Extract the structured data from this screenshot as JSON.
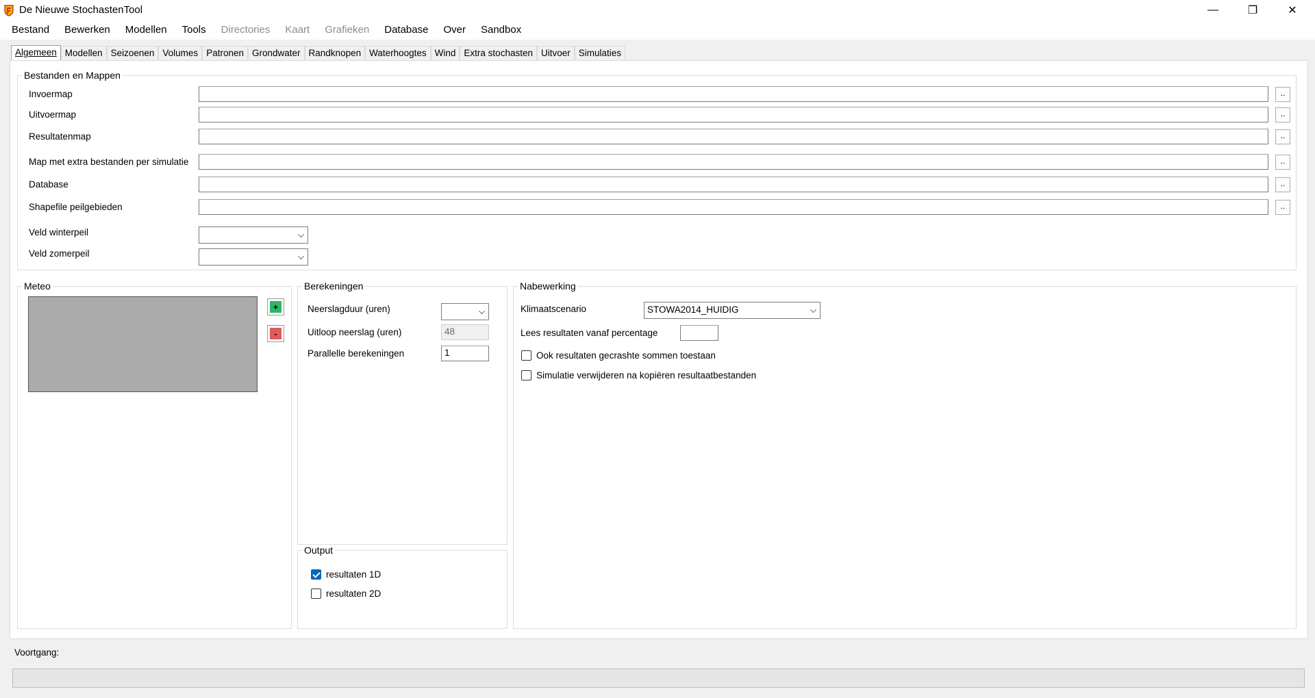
{
  "window": {
    "title": "De Nieuwe StochastenTool",
    "controls": {
      "minimize": "—",
      "restore": "❐",
      "close": "✕"
    }
  },
  "menu": [
    {
      "label": "Bestand",
      "enabled": true
    },
    {
      "label": "Bewerken",
      "enabled": true
    },
    {
      "label": "Modellen",
      "enabled": true
    },
    {
      "label": "Tools",
      "enabled": true
    },
    {
      "label": "Directories",
      "enabled": false
    },
    {
      "label": "Kaart",
      "enabled": false
    },
    {
      "label": "Grafieken",
      "enabled": false
    },
    {
      "label": "Database",
      "enabled": true
    },
    {
      "label": "Over",
      "enabled": true
    },
    {
      "label": "Sandbox",
      "enabled": true
    }
  ],
  "tabs": [
    {
      "label": "Algemeen",
      "active": true
    },
    {
      "label": "Modellen"
    },
    {
      "label": "Seizoenen"
    },
    {
      "label": "Volumes"
    },
    {
      "label": "Patronen"
    },
    {
      "label": "Grondwater"
    },
    {
      "label": "Randknopen"
    },
    {
      "label": "Waterhoogtes"
    },
    {
      "label": "Wind"
    },
    {
      "label": "Extra stochasten"
    },
    {
      "label": "Uitvoer"
    },
    {
      "label": "Simulaties"
    }
  ],
  "bestanden": {
    "title": "Bestanden en Mappen",
    "fields": [
      {
        "label": "Invoermap",
        "value": "",
        "browse": ".."
      },
      {
        "label": "Uitvoermap",
        "value": "",
        "browse": ".."
      },
      {
        "label": "Resultatenmap",
        "value": "",
        "browse": ".."
      },
      {
        "label": "Map met extra bestanden per simulatie",
        "value": "",
        "browse": ".."
      },
      {
        "label": "Database",
        "value": "",
        "browse": ".."
      },
      {
        "label": "Shapefile peilgebieden",
        "value": "",
        "browse": ".."
      }
    ],
    "veld_winterpeil": {
      "label": "Veld winterpeil",
      "value": ""
    },
    "veld_zomerpeil": {
      "label": "Veld zomerpeil",
      "value": ""
    }
  },
  "meteo": {
    "title": "Meteo",
    "add_label": "+",
    "remove_label": "-",
    "add_color": "#2fb36a",
    "remove_color": "#e05a5a"
  },
  "berekeningen": {
    "title": "Berekeningen",
    "neerslagduur": {
      "label": "Neerslagduur (uren)",
      "value": ""
    },
    "uitloop": {
      "label": "Uitloop neerslag (uren)",
      "value": "48"
    },
    "parallelle": {
      "label": "Parallelle berekeningen",
      "value": "1"
    }
  },
  "output": {
    "title": "Output",
    "res1d": {
      "label": "resultaten 1D",
      "checked": true
    },
    "res2d": {
      "label": "resultaten 2D",
      "checked": false
    }
  },
  "nabewerking": {
    "title": "Nabewerking",
    "klimaatscenario": {
      "label": "Klimaatscenario",
      "value": "STOWA2014_HUIDIG"
    },
    "lees_percentage": {
      "label": "Lees resultaten vanaf percentage",
      "value": ""
    },
    "ook_gecrashte": {
      "label": "Ook resultaten gecrashte sommen toestaan",
      "checked": false
    },
    "simulatie_verwijderen": {
      "label": "Simulatie verwijderen na kopiëren resultaatbestanden",
      "checked": false
    }
  },
  "voortgang": {
    "label": "Voortgang:",
    "progress": 0
  }
}
